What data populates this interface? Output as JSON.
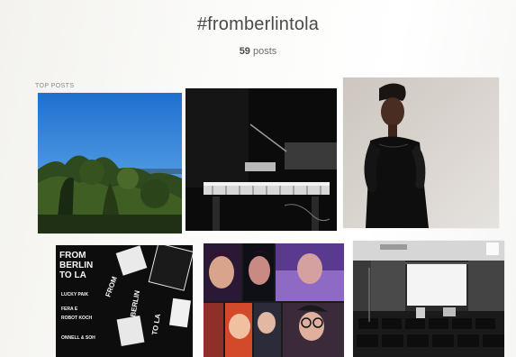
{
  "header": {
    "hashtag": "#fromberlintola",
    "post_count_number": "59",
    "post_count_word": "posts"
  },
  "top_posts": {
    "label": "TOP POSTS"
  },
  "grid": {
    "posters": {
      "line1": "FROM",
      "line2": "BERLIN",
      "line3": "TO LA",
      "side_text_1": "LUCKY PAIK",
      "side_text_2": "FERA E",
      "side_text_3": "ROBOT KOCH",
      "side_text_4": "ONNELL & SOH",
      "vertical_1": "FROM",
      "vertical_2": "BERLIN",
      "vertical_3": "TO LA"
    }
  },
  "colors": {
    "sky_blue": "#2f7fd6",
    "hashtag_gray": "#4a4a4a",
    "label_gray": "#8a8a8a"
  }
}
